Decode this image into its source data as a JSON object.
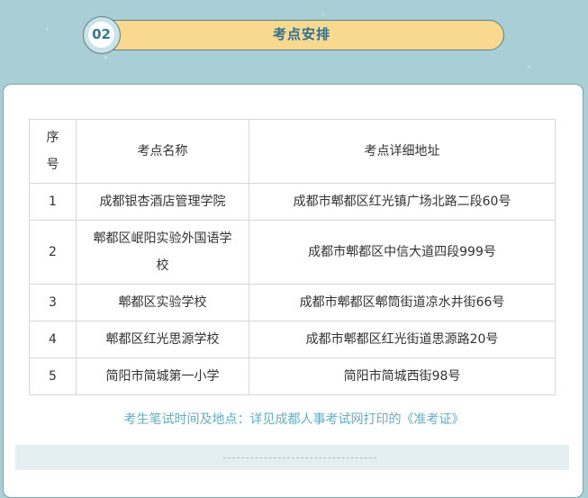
{
  "header": {
    "number": "02",
    "title": "考点安排"
  },
  "table": {
    "headers": {
      "index": "序号",
      "name": "考点名称",
      "address": "考点详细地址"
    },
    "rows": [
      {
        "index": "1",
        "name": "成都银杏酒店管理学院",
        "address": "成都市郫都区红光镇广场北路二段60号"
      },
      {
        "index": "2",
        "name": "郫都区岷阳实验外国语学校",
        "address": "成都市郫都区中信大道四段999号"
      },
      {
        "index": "3",
        "name": "郫都区实验学校",
        "address": "成都市郫都区郫筒街道凉水井街66号"
      },
      {
        "index": "4",
        "name": "郫都区红光思源学校",
        "address": "成都市郫都区红光街道思源路20号"
      },
      {
        "index": "5",
        "name": "简阳市简城第一小学",
        "address": "简阳市简城西街98号"
      }
    ]
  },
  "note": "考生笔试时间及地点：详见成都人事考试网打印的《准考证》",
  "colors": {
    "background": "#a9cfd6",
    "pill": "#f9d890",
    "title_text": "#2f6f92",
    "note_text": "#63afc7"
  }
}
